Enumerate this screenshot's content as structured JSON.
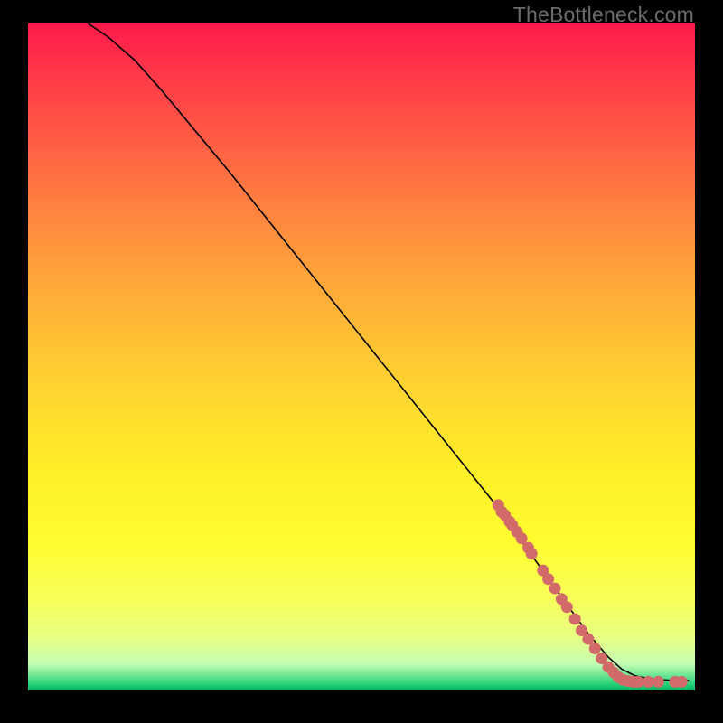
{
  "watermark": "TheBottleneck.com",
  "chart_data": {
    "type": "line",
    "title": "",
    "xlabel": "",
    "ylabel": "",
    "xlim": [
      0,
      100
    ],
    "ylim": [
      0,
      100
    ],
    "curve": {
      "name": "bottleneck-curve",
      "points_xy": [
        [
          9,
          100
        ],
        [
          12,
          98
        ],
        [
          16,
          94.5
        ],
        [
          20,
          90
        ],
        [
          30,
          78
        ],
        [
          40,
          65.5
        ],
        [
          50,
          53
        ],
        [
          60,
          40.5
        ],
        [
          70,
          28
        ],
        [
          75,
          21
        ],
        [
          80,
          14
        ],
        [
          84,
          8.5
        ],
        [
          87,
          5
        ],
        [
          89,
          3.2
        ],
        [
          91,
          2.2
        ],
        [
          93,
          1.8
        ],
        [
          95,
          1.6
        ],
        [
          97,
          1.5
        ],
        [
          99,
          1.5
        ]
      ]
    },
    "markers": {
      "name": "data-markers",
      "color": "#d36a6a",
      "points_xy": [
        [
          70.5,
          27.8
        ],
        [
          71.0,
          26.8
        ],
        [
          71.5,
          26.3
        ],
        [
          72.2,
          25.3
        ],
        [
          72.6,
          24.8
        ],
        [
          73.3,
          23.8
        ],
        [
          74.0,
          22.8
        ],
        [
          75.0,
          21.4
        ],
        [
          75.5,
          20.5
        ],
        [
          77.2,
          18.0
        ],
        [
          78.0,
          16.7
        ],
        [
          79.0,
          15.3
        ],
        [
          80.0,
          13.7
        ],
        [
          80.8,
          12.5
        ],
        [
          82.0,
          10.7
        ],
        [
          83.0,
          9.0
        ],
        [
          84.0,
          7.7
        ],
        [
          85.0,
          6.3
        ],
        [
          86.0,
          4.8
        ],
        [
          87.0,
          3.5
        ],
        [
          87.8,
          2.7
        ],
        [
          88.5,
          2.0
        ],
        [
          89.2,
          1.6
        ],
        [
          90.0,
          1.4
        ],
        [
          90.8,
          1.3
        ],
        [
          91.5,
          1.3
        ],
        [
          93.0,
          1.3
        ],
        [
          94.5,
          1.3
        ],
        [
          97.0,
          1.3
        ],
        [
          98.0,
          1.3
        ]
      ]
    }
  }
}
